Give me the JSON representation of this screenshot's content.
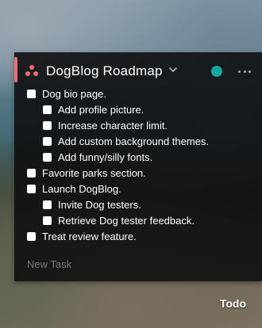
{
  "header": {
    "title": "DogBlog Roadmap",
    "status_color": "#19a6a0",
    "accent_color": "#f06a78"
  },
  "tasks": [
    {
      "label": "Dog bio page.",
      "level": 0
    },
    {
      "label": "Add profile picture.",
      "level": 1
    },
    {
      "label": "Increase character limit.",
      "level": 1
    },
    {
      "label": "Add custom background themes.",
      "level": 1
    },
    {
      "label": "Add funny/silly fonts.",
      "level": 1
    },
    {
      "label": "Favorite parks section.",
      "level": 0
    },
    {
      "label": "Launch DogBlog.",
      "level": 0
    },
    {
      "label": "Invite Dog testers.",
      "level": 1
    },
    {
      "label": "Retrieve Dog tester feedback.",
      "level": 1
    },
    {
      "label": "Treat review feature.",
      "level": 0
    }
  ],
  "new_task": {
    "placeholder": "New Task"
  },
  "footer": {
    "label": "Todo"
  },
  "icons": {
    "app": "three-dots-logo-icon",
    "chevron": "chevron-down-icon",
    "status": "status-dot-icon",
    "more": "more-horizontal-icon"
  }
}
